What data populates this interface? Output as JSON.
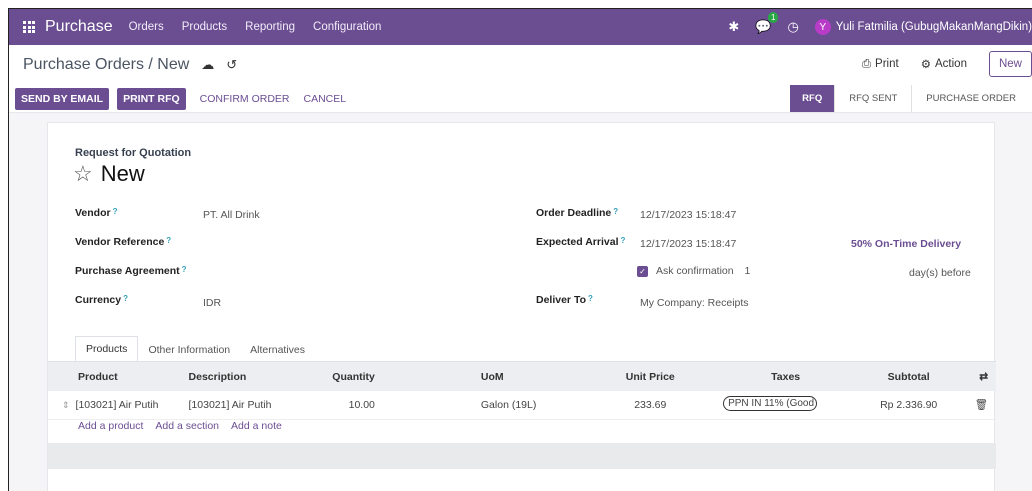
{
  "nav": {
    "brand": "Purchase",
    "menu": [
      "Orders",
      "Products",
      "Reporting",
      "Configuration"
    ],
    "chat_badge": "1",
    "user_initial": "Y",
    "user_name": "Yuli Fatmilia (GubugMakanMangDikin)"
  },
  "breadcrumb": {
    "text": "Purchase Orders / New",
    "print_label": "Print",
    "action_label": "Action",
    "new_label": "New"
  },
  "actions": {
    "send_by_email": "SEND BY EMAIL",
    "print_rfq": "PRINT RFQ",
    "confirm_order": "CONFIRM ORDER",
    "cancel": "CANCEL"
  },
  "statusbar": [
    "RFQ",
    "RFQ SENT",
    "PURCHASE ORDER"
  ],
  "form": {
    "doc_type": "Request for Quotation",
    "title": "New",
    "vendor_label": "Vendor",
    "vendor_value": "PT. All Drink",
    "vendor_ref_label": "Vendor Reference",
    "purchase_agreement_label": "Purchase Agreement",
    "currency_label": "Currency",
    "currency_value": "IDR",
    "order_deadline_label": "Order Deadline",
    "order_deadline_value": "12/17/2023 15:18:47",
    "expected_arrival_label": "Expected Arrival",
    "expected_arrival_value": "12/17/2023 15:18:47",
    "ontime": "50% On-Time Delivery",
    "ask_confirmation_label": "Ask confirmation",
    "ask_confirmation_days": "1",
    "days_before": "day(s) before",
    "deliver_to_label": "Deliver To",
    "deliver_to_value": "My Company: Receipts",
    "tooltip_mark": "?"
  },
  "tabs": [
    "Products",
    "Other Information",
    "Alternatives"
  ],
  "table": {
    "headers": [
      "Product",
      "Description",
      "Quantity",
      "UoM",
      "Unit Price",
      "Taxes",
      "Subtotal"
    ],
    "rows": [
      {
        "product": "[103021] Air Putih",
        "description": "[103021] Air Putih",
        "quantity": "10.00",
        "uom": "Galon (19L)",
        "unit_price": "233.69",
        "taxes": "PPN IN 11% (Good",
        "subtotal": "Rp 2.336.90"
      }
    ],
    "add_product": "Add a product",
    "add_section": "Add a section",
    "add_note": "Add a note"
  }
}
